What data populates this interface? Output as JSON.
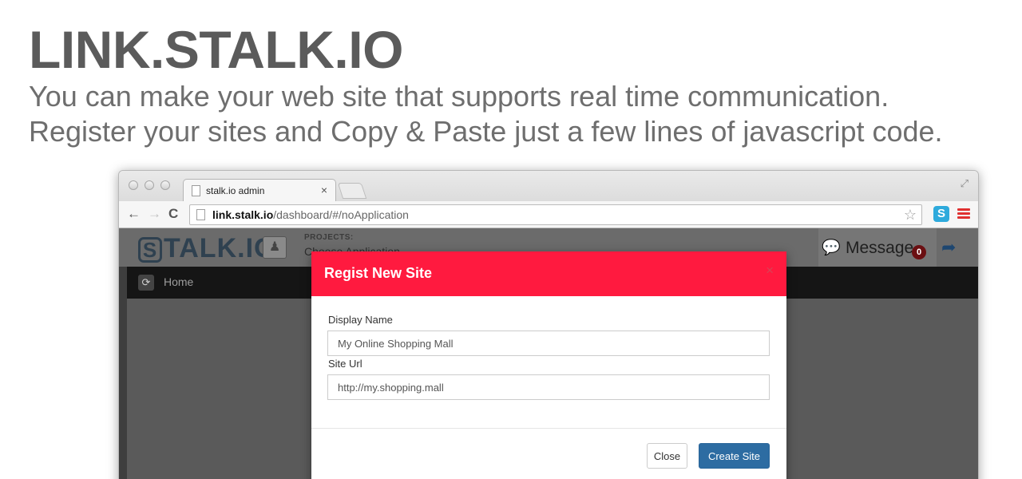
{
  "hero": {
    "title": "LINK.STALK.IO",
    "line1": "You can make your web site that supports real time communication.",
    "line2": "Register your sites and Copy & Paste just a few lines of javascript code."
  },
  "browser": {
    "tab_title": "stalk.io admin",
    "tab_close": "×",
    "url_host": "link.stalk.io",
    "url_path": "/dashboard/#/noApplication",
    "ext_letter": "S"
  },
  "app": {
    "logo_text": "TALK.IO",
    "logo_mark": "S",
    "projects_label": "PROJECTS:",
    "projects_value": "Choose Application ...",
    "message_label": "Message",
    "message_count": "0",
    "nav_home": "Home"
  },
  "modal": {
    "title": "Regist New Site",
    "close_x": "×",
    "display_name_label": "Display Name",
    "display_name_value": "My Online Shopping Mall",
    "site_url_label": "Site Url",
    "site_url_value": "http://my.shopping.mall",
    "close_button": "Close",
    "create_button": "Create Site"
  },
  "colors": {
    "modal_header": "#ff1a3f",
    "primary_button": "#2d6ca2",
    "nav_bar": "#151515"
  }
}
